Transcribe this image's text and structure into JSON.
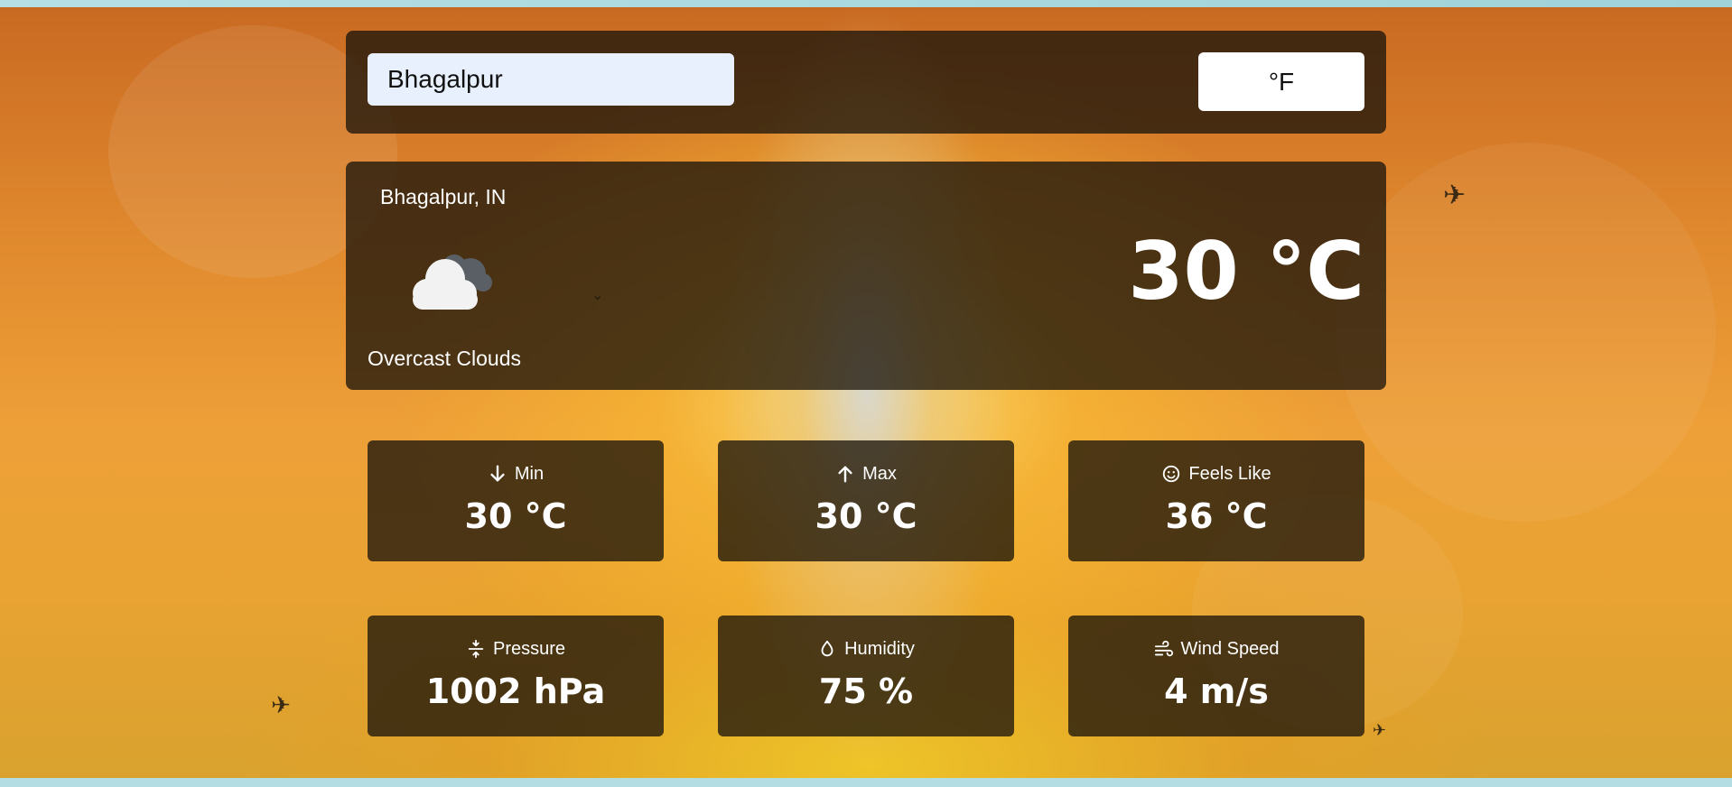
{
  "search": {
    "value": "Bhagalpur"
  },
  "unit_toggle": {
    "label": "°F"
  },
  "current": {
    "location": "Bhagalpur, IN",
    "icon": "overcast-clouds-icon",
    "condition": "Overcast Clouds",
    "temperature": "30 °C"
  },
  "stats": [
    {
      "icon": "arrow-down-icon",
      "label": "Min",
      "value": "30 °C"
    },
    {
      "icon": "arrow-up-icon",
      "label": "Max",
      "value": "30 °C"
    },
    {
      "icon": "smile-icon",
      "label": "Feels Like",
      "value": "36 °C"
    },
    {
      "icon": "pressure-icon",
      "label": "Pressure",
      "value": "1002 hPa"
    },
    {
      "icon": "droplet-icon",
      "label": "Humidity",
      "value": "75 %"
    },
    {
      "icon": "wind-icon",
      "label": "Wind Speed",
      "value": "4 m/s"
    }
  ]
}
